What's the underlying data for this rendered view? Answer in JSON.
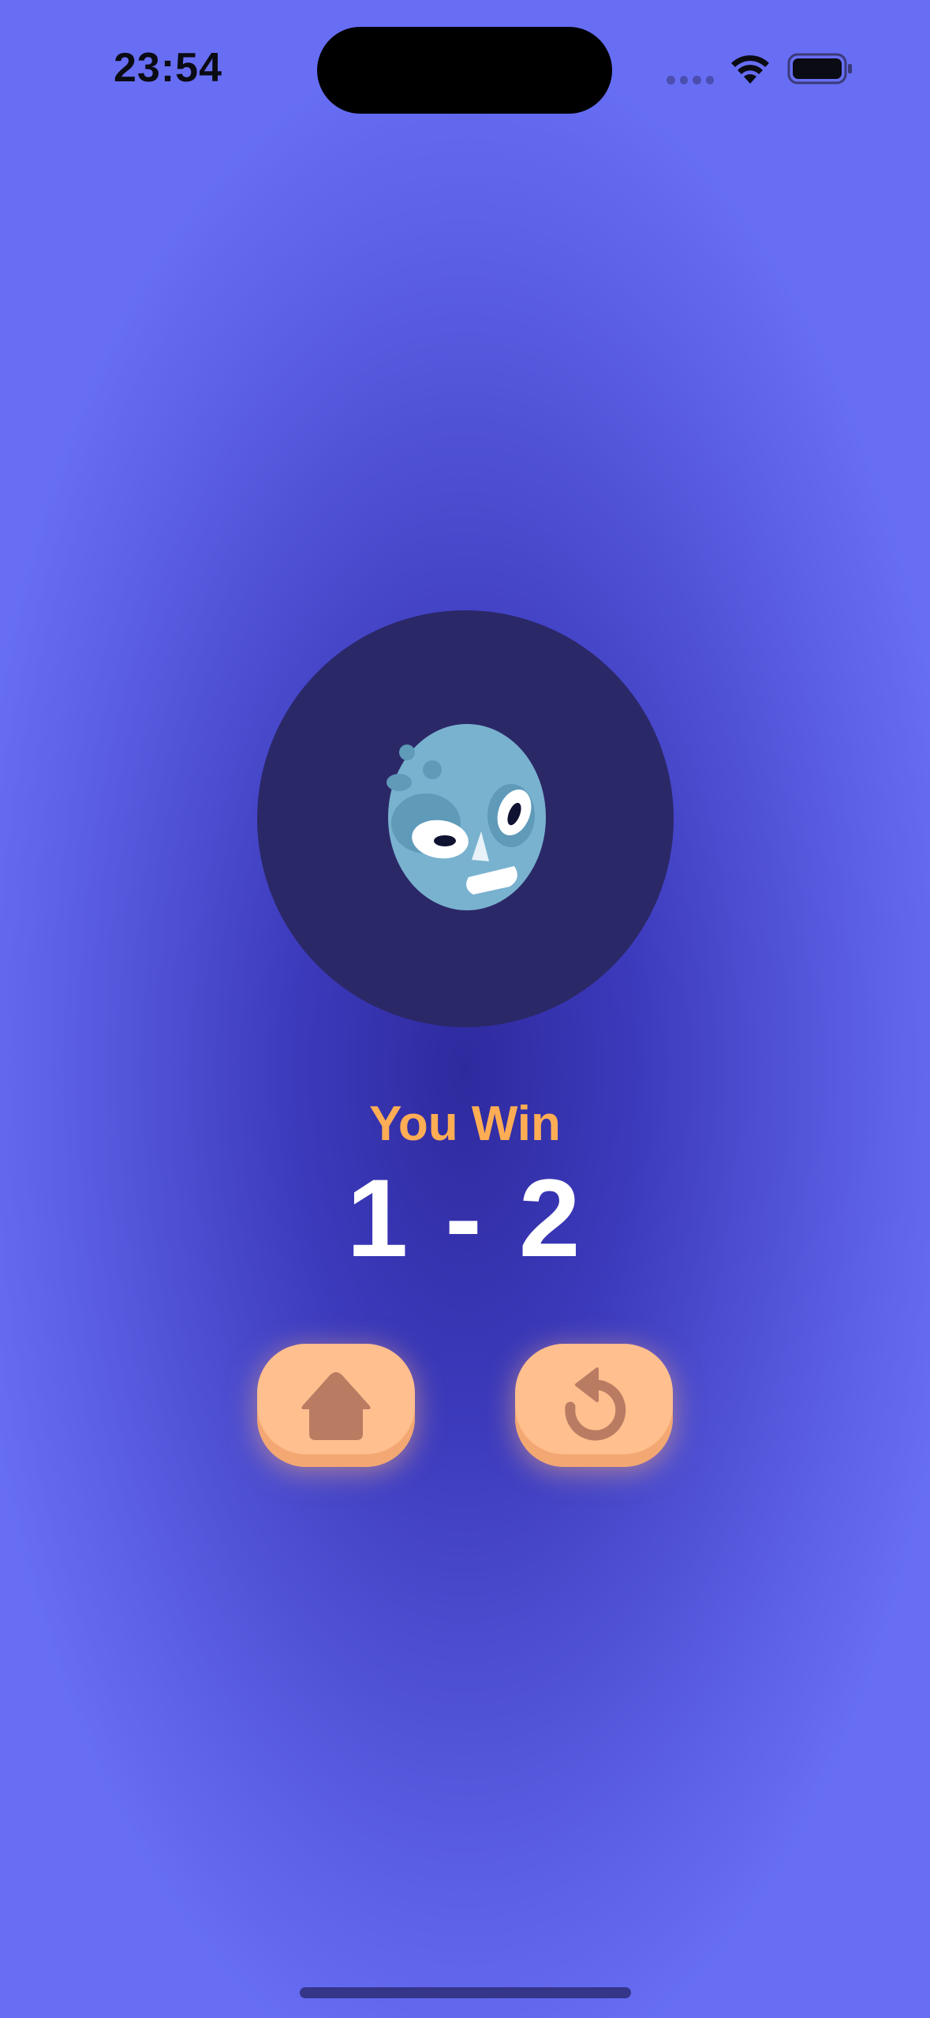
{
  "status_bar": {
    "time": "23:54",
    "icons": [
      "cellular-signal-icon",
      "wifi-icon",
      "battery-icon"
    ]
  },
  "opponent": {
    "avatar_icon": "zombie-face-icon"
  },
  "result": {
    "label": "You Win",
    "score": "1 - 2"
  },
  "actions": {
    "home_icon": "house-icon",
    "restart_icon": "restart-arrow-icon"
  },
  "colors": {
    "background_center": "#2e2a9e",
    "background_edge": "#676ef4",
    "avatar_circle": "#2b2868",
    "result_label": "#ffad55",
    "score": "#ffffff",
    "button_fill": "#ffbf8e",
    "button_icon": "#b97c63"
  }
}
